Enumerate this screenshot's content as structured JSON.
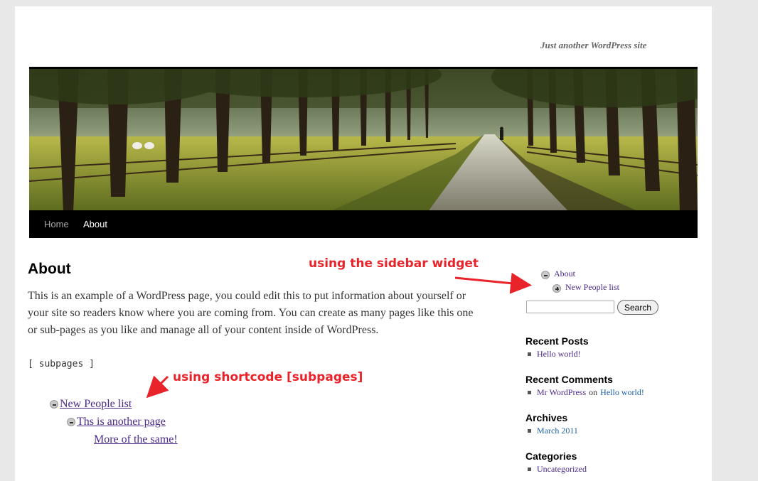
{
  "header": {
    "tagline": "Just another WordPress site"
  },
  "nav": {
    "items": [
      {
        "label": "Home"
      },
      {
        "label": "About"
      }
    ]
  },
  "content": {
    "title": "About",
    "body": "This is an example of a WordPress page, you could edit this to put information about yourself or your site so readers know where you are coming from. You can create as many pages like this one or sub-pages as you like and manage all of your content inside of WordPress.",
    "shortcode": "[ subpages ]",
    "subpages": [
      {
        "label": "New People list"
      },
      {
        "label": "Ths is another page"
      },
      {
        "label": "More of the same!"
      }
    ]
  },
  "annotations": {
    "sidebar_widget": "using the sidebar widget",
    "shortcode": "using shortcode [subpages]"
  },
  "sidebar": {
    "pages": [
      {
        "label": "About"
      },
      {
        "label": "New People list"
      }
    ],
    "search": {
      "button_label": "Search",
      "value": ""
    },
    "widgets": {
      "recent_posts": {
        "title": "Recent Posts",
        "items": [
          "Hello world!"
        ]
      },
      "recent_comments": {
        "title": "Recent Comments",
        "author": "Mr WordPress",
        "on": "on",
        "post": "Hello world!"
      },
      "archives": {
        "title": "Archives",
        "items": [
          "March 2011"
        ]
      },
      "categories": {
        "title": "Categories",
        "items": [
          "Uncategorized"
        ]
      }
    }
  },
  "colors": {
    "annotation": "#e8232a",
    "link": "#4b2a8a",
    "link_alt": "#1b5fa7",
    "nav_bg": "#000000"
  }
}
